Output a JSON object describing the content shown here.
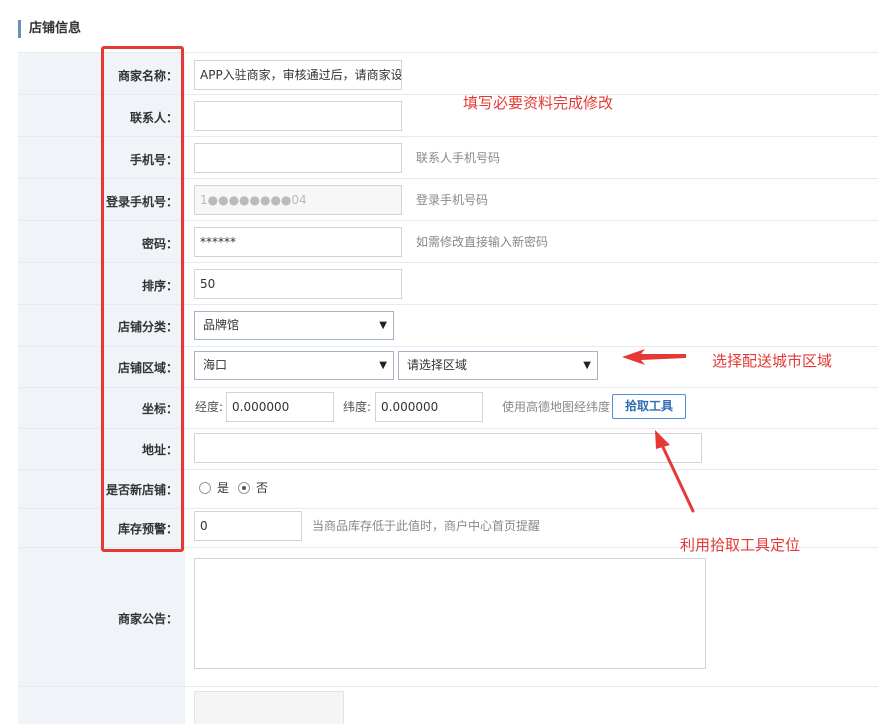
{
  "section": {
    "title": "店铺信息"
  },
  "form": {
    "shop_name": {
      "label": "商家名称：",
      "value": "APP入驻商家，审核通过后，请商家设"
    },
    "contact": {
      "label": "联系人：",
      "value": ""
    },
    "phone": {
      "label": "手机号：",
      "value": "",
      "hint": "联系人手机号码"
    },
    "login_phone": {
      "label": "登录手机号：",
      "value": "1●●●●●●●●04",
      "hint": "登录手机号码"
    },
    "password": {
      "label": "密码：",
      "value": "******",
      "hint": "如需修改直接输入新密码"
    },
    "sort": {
      "label": "排序：",
      "value": "50"
    },
    "category": {
      "label": "店铺分类：",
      "selected": "品牌馆"
    },
    "region": {
      "label": "店铺区域：",
      "city": "海口",
      "area": "请选择区域"
    },
    "coords": {
      "label": "坐标：",
      "lng_label": "经度:",
      "lng": "0.000000",
      "lat_label": "纬度:",
      "lat": "0.000000",
      "hint": "使用高德地图经纬度",
      "pick_button": "拾取工具"
    },
    "address": {
      "label": "地址：",
      "value": ""
    },
    "is_new": {
      "label": "是否新店铺：",
      "yes": "是",
      "no": "否",
      "selected": "否"
    },
    "stock_alert": {
      "label": "库存预警：",
      "value": "0",
      "hint": "当商品库存低于此值时，商户中心首页提醒"
    },
    "notice": {
      "label": "商家公告：",
      "value": ""
    }
  },
  "annotations": {
    "fill_required": "填写必要资料完成修改",
    "select_region": "选择配送城市区域",
    "use_pick_tool": "利用拾取工具定位"
  },
  "colors": {
    "annotation_red": "#e53935",
    "accent_blue": "#4a90d9",
    "label_bg": "#f0f3f8"
  }
}
